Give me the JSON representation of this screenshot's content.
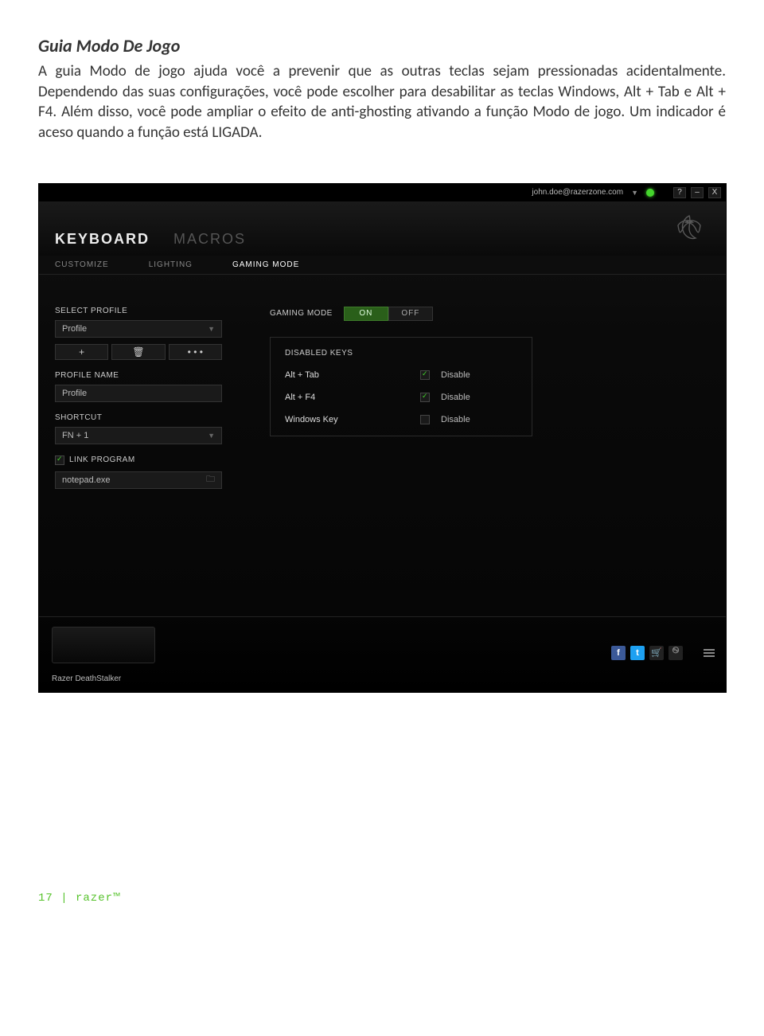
{
  "document": {
    "title": "Guia Modo De Jogo",
    "paragraph": "A guia Modo de jogo ajuda você a prevenir que as outras teclas sejam pressionadas acidentalmente. Dependendo das suas configurações, você pode escolher para desabilitar as teclas Windows, Alt + Tab e Alt + F4. Além disso, você pode ampliar o efeito de anti-ghosting ativando a função Modo de jogo. Um indicador é aceso quando a função está LIGADA."
  },
  "app": {
    "topbar": {
      "email": "john.doe@razerzone.com",
      "help": "?",
      "min": "–",
      "close": "X"
    },
    "mainTabs": {
      "keyboard": "KEYBOARD",
      "macros": "MACROS"
    },
    "subTabs": {
      "customize": "CUSTOMIZE",
      "lighting": "LIGHTING",
      "gaming": "GAMING MODE"
    },
    "sidebar": {
      "selectProfileLabel": "SELECT PROFILE",
      "profileValue": "Profile",
      "plus": "+",
      "trash": "🗑",
      "dots": "• • •",
      "profileNameLabel": "PROFILE NAME",
      "profileNameValue": "Profile",
      "shortcutLabel": "SHORTCUT",
      "shortcutValue": "FN + 1",
      "linkProgramLabel": "LINK PROGRAM",
      "linkedFile": "notepad.exe"
    },
    "gamingMode": {
      "label": "GAMING MODE",
      "on": "ON",
      "off": "OFF",
      "disabledKeysTitle": "DISABLED KEYS",
      "rows": [
        {
          "name": "Alt + Tab",
          "checked": true,
          "label": "Disable"
        },
        {
          "name": "Alt + F4",
          "checked": true,
          "label": "Disable"
        },
        {
          "name": "Windows Key",
          "checked": false,
          "label": "Disable"
        }
      ]
    },
    "footer": {
      "deviceName": "Razer DeathStalker"
    }
  },
  "pageFooter": "17 | razer™"
}
